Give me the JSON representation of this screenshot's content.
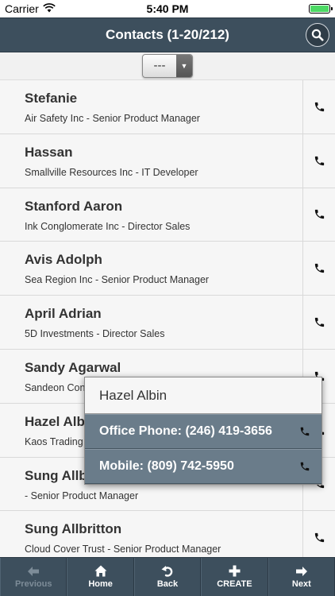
{
  "status_bar": {
    "carrier": "Carrier",
    "time": "5:40 PM",
    "battery_level": 1.0,
    "battery_color": "#4cd964"
  },
  "header": {
    "title": "Contacts (1-20/212)",
    "search_icon": "search-icon"
  },
  "filter": {
    "selected": "---"
  },
  "contacts": [
    {
      "name": "Stefanie",
      "detail": "Air Safety Inc - Senior Product Manager"
    },
    {
      "name": "Hassan",
      "detail": "Smallville Resources Inc - IT Developer"
    },
    {
      "name": "Stanford Aaron",
      "detail": "Ink Conglomerate Inc - Director Sales"
    },
    {
      "name": "Avis Adolph",
      "detail": "Sea Region Inc - Senior Product Manager"
    },
    {
      "name": "April Adrian",
      "detail": "5D Investments - Director Sales"
    },
    {
      "name": "Sandy Agarwal",
      "detail": "Sandeon Con"
    },
    {
      "name": "Hazel Alb",
      "detail": "Kaos Trading"
    },
    {
      "name": "Sung Allb",
      "detail": "- Senior Product Manager"
    },
    {
      "name": "Sung Allbritton",
      "detail": "Cloud Cover Trust - Senior Product Manager"
    }
  ],
  "popup": {
    "title": "Hazel Albin",
    "items": [
      {
        "label": "Office Phone: (246) 419-3656"
      },
      {
        "label": "Mobile: (809) 742-5950"
      }
    ]
  },
  "toolbar": {
    "previous": "Previous",
    "home": "Home",
    "back": "Back",
    "create": "CREATE",
    "next": "Next"
  },
  "colors": {
    "header_bg": "#3d4f5d",
    "popup_item_bg": "#6a7c8a",
    "toolbar_disabled": "#7d8c98"
  }
}
